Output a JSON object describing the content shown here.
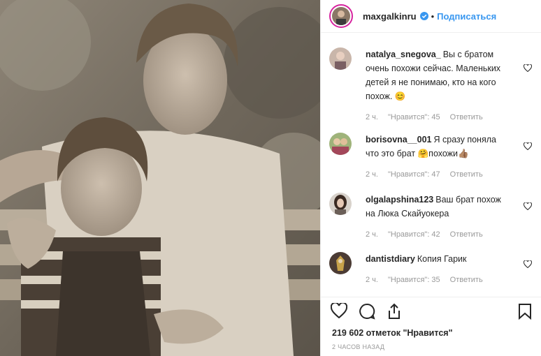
{
  "header": {
    "username": "maxgalkinru",
    "separator": "•",
    "follow_label": "Подписаться"
  },
  "comments": [
    {
      "user": "natalya_snegova_",
      "text": "Вы с братом очень похожи сейчас. Маленьких детей я не понимаю, кто на кого похож. 😊",
      "time": "2 ч.",
      "likes": "\"Нравится\": 45",
      "reply": "Ответить"
    },
    {
      "user": "borisovna__001",
      "text": "Я сразу поняла что это брат 🤗похожи👍🏽",
      "time": "2 ч.",
      "likes": "\"Нравится\": 47",
      "reply": "Ответить"
    },
    {
      "user": "olgalapshina123",
      "text": "Ваш брат похож на Люка Скайуокера",
      "time": "2 ч.",
      "likes": "\"Нравится\": 42",
      "reply": "Ответить"
    },
    {
      "user": "dantistdiary",
      "text": "Копия Гарик",
      "time": "2 ч.",
      "likes": "\"Нравится\": 35",
      "reply": "Ответить"
    }
  ],
  "post": {
    "likes_count": "219 602 отметок \"Нравится\"",
    "timestamp": "2 ЧАСОВ НАЗАД"
  },
  "colors": {
    "accent": "#3897f0",
    "muted": "#999999",
    "photo_tint": "#7d7468"
  },
  "icons": [
    "verified-badge-icon",
    "heart-icon",
    "comment-icon",
    "share-icon",
    "bookmark-icon"
  ]
}
